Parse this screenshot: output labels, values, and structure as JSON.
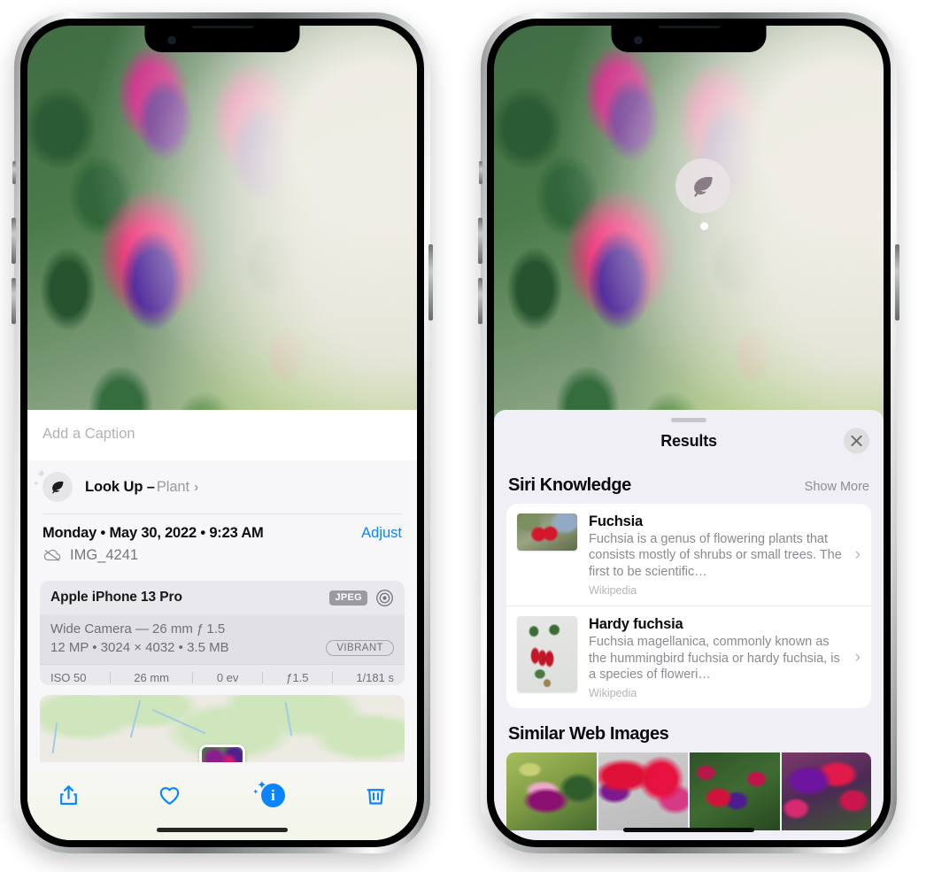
{
  "left_phone": {
    "photo": {
      "alt": "fuchsia-flowers-photo"
    },
    "caption_placeholder": "Add a Caption",
    "lookup_row": {
      "icon": "leaf-icon",
      "label": "Look Up –",
      "subject": "Plant",
      "chevron": "›"
    },
    "meta": {
      "date": "Monday • May 30, 2022 • 9:23 AM",
      "adjust_label": "Adjust",
      "cloud_icon": "icloud-slash-icon",
      "filename": "IMG_4241"
    },
    "camera_card": {
      "device": "Apple iPhone 13 Pro",
      "format_badge": "JPEG",
      "aperture_icon": "aperture-icon",
      "lens_line": "Wide Camera — 26 mm ƒ 1.5",
      "specs_line": "12 MP  •  3024 × 4032  •  3.5 MB",
      "profile_pill": "VIBRANT",
      "exif": [
        "ISO 50",
        "26 mm",
        "0 ev",
        "ƒ1.5",
        "1/181 s"
      ]
    },
    "map": {
      "name": "photo-location-map",
      "pin": "photo-pin"
    },
    "toolbar": [
      {
        "name": "share-button",
        "icon": "share-icon"
      },
      {
        "name": "favorite-button",
        "icon": "heart-icon"
      },
      {
        "name": "info-button",
        "icon": "info-sparkle-icon",
        "glyph": "i"
      },
      {
        "name": "delete-button",
        "icon": "trash-icon"
      }
    ]
  },
  "right_phone": {
    "photo": {
      "alt": "fuchsia-flowers-photo"
    },
    "lookup_badge": {
      "icon": "leaf-icon"
    },
    "sheet": {
      "title": "Results",
      "close_icon": "close-icon",
      "siri_knowledge": {
        "title": "Siri Knowledge",
        "show_more": "Show More",
        "items": [
          {
            "title": "Fuchsia",
            "description": "Fuchsia is a genus of flowering plants that consists mostly of shrubs or small trees. The first to be scientific…",
            "source": "Wikipedia",
            "thumb": "fuchsia-red-flowers-thumb",
            "chevron": "›"
          },
          {
            "title": "Hardy fuchsia",
            "description": "Fuchsia magellanica, commonly known as the hummingbird fuchsia or hardy fuchsia, is a species of floweri…",
            "source": "Wikipedia",
            "thumb": "hardy-fuchsia-specimen-thumb",
            "chevron": "›"
          }
        ]
      },
      "similar_web_images": {
        "title": "Similar Web Images",
        "items": [
          {
            "name": "similar-image-1"
          },
          {
            "name": "similar-image-2"
          },
          {
            "name": "similar-image-3"
          },
          {
            "name": "similar-image-4"
          }
        ]
      }
    }
  },
  "colors": {
    "accent_blue": "#0a84ff",
    "sheet_bg": "#f0eff5",
    "info_bg": "#f7f7f9",
    "card_bg": "#e9e9ed"
  }
}
